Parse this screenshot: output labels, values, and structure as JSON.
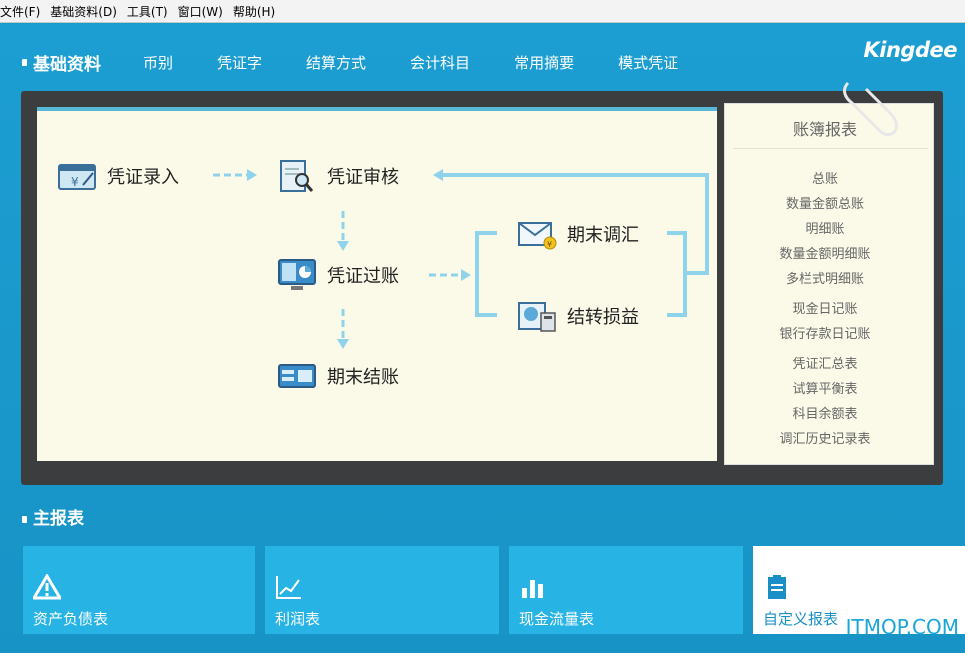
{
  "menubar": {
    "items": [
      "文件(F)",
      "基础资料(D)",
      "工具(T)",
      "窗口(W)",
      "帮助(H)"
    ]
  },
  "basic": {
    "title": "基础资料",
    "links": [
      "币别",
      "凭证字",
      "结算方式",
      "会计科目",
      "常用摘要",
      "模式凭证"
    ]
  },
  "brand": "Kingdee",
  "flow": {
    "entry": "凭证录入",
    "review": "凭证审核",
    "post": "凭证过账",
    "close": "期末结账",
    "adjust": "期末调汇",
    "carry": "结转损益"
  },
  "ledger": {
    "title": "账簿报表",
    "groups": [
      [
        "总账",
        "数量金额总账",
        "明细账",
        "数量金额明细账",
        "多栏式明细账"
      ],
      [
        "现金日记账",
        "银行存款日记账"
      ],
      [
        "凭证汇总表",
        "试算平衡表",
        "科目余额表",
        "调汇历史记录表"
      ]
    ]
  },
  "reports": {
    "title": "主报表",
    "tiles": [
      "资产负债表",
      "利润表",
      "现金流量表",
      "自定义报表"
    ]
  },
  "watermark": "ITMOP.COM",
  "colors": {
    "background": "#1a9bd0",
    "panel": "#3b3d3f",
    "paper": "#fbfae9",
    "arrow": "#8fd3ea",
    "tile": "#27b3e4"
  }
}
